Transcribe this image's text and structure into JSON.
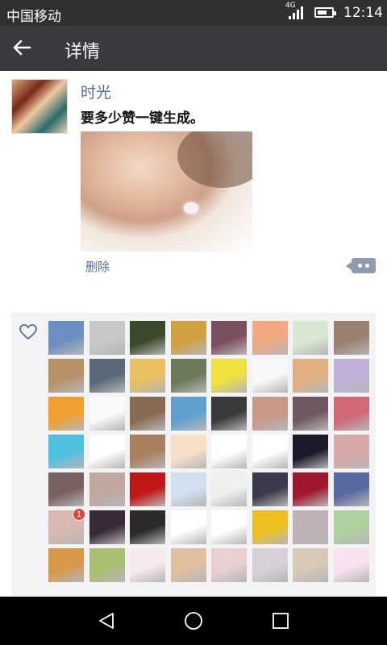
{
  "status_bar": {
    "carrier": "中国移动",
    "network": "4G",
    "time": "12:14",
    "battery_level": 0.7
  },
  "toolbar": {
    "back_icon": "arrow-left-icon",
    "title": "详情"
  },
  "post": {
    "username": "时光",
    "content": "要多少赞一键生成。",
    "delete_label": "删除",
    "comment_icon": "comment-more-icon",
    "photo_icon": "photo-image"
  },
  "likes": {
    "heart_icon": "heart-outline-icon",
    "badge": "1",
    "avatars": [
      "#6a8fc0",
      "#c8c8c8",
      "#3a4a2a",
      "#d0a040",
      "#7a5060",
      "#f2a880",
      "#d8e8d0",
      "#9a8070",
      "#b89068",
      "#5a6a7a",
      "#e8c060",
      "#6a7a5a",
      "#f0e040",
      "#f8f8f8",
      "#e0b080",
      "#c0b0d8",
      "#f0a030",
      "#fafafa",
      "#8a6a50",
      "#60a0d0",
      "#3a3a3a",
      "#c89888",
      "#705860",
      "#d06878",
      "#50c0e0",
      "#ffffff",
      "#a88060",
      "#f8e0c8",
      "#ffffff",
      "#ffffff",
      "#1a1a2a",
      "#d8a8a8",
      "#7a6060",
      "#c0a8a0",
      "#c01818",
      "#d0e0f0",
      "#f0f0f0",
      "#3a3a4a",
      "#a01830",
      "#5a6aa0",
      "#d8b8b0",
      "#3a2a38",
      "#2a2a2a",
      "#ffffff",
      "#ffffff",
      "#f0c020",
      "#c0b0b8",
      "#b0d0a0",
      "#d89848",
      "#a8c070",
      "#f8e8f0",
      "#e0c0a0",
      "#e8d0d0",
      "#d8d0d8",
      "#d8c8b8",
      "#f8e0f0"
    ]
  },
  "nav_bar": {
    "back_icon": "triangle-back-icon",
    "home_icon": "circle-home-icon",
    "recent_icon": "square-recent-icon"
  }
}
